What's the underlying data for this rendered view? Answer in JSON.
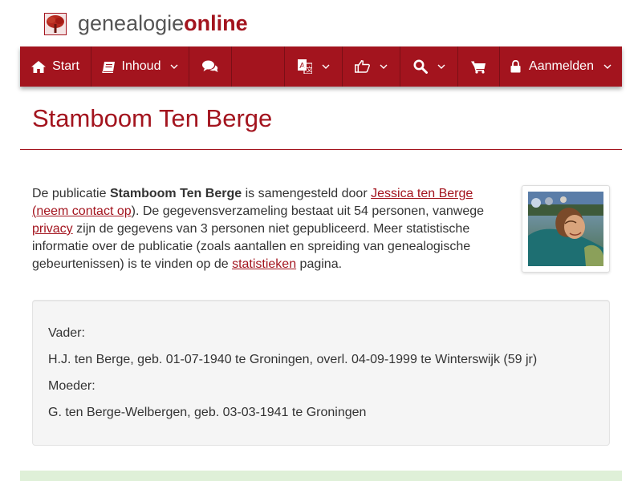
{
  "site": {
    "logo_regular": "genealogie",
    "logo_bold": "online",
    "brand_color": "#a3141e"
  },
  "nav": {
    "start_label": "Start",
    "content_label": "Inhoud",
    "login_label": "Aanmelden",
    "icons": [
      "home-icon",
      "book-icon",
      "chat-icon",
      "translate-icon",
      "thumbs-up-icon",
      "search-icon",
      "cart-icon",
      "lock-icon"
    ]
  },
  "page": {
    "title": "Stamboom Ten Berge"
  },
  "intro": {
    "t1": "De publicatie ",
    "publication": "Stamboom Ten Berge",
    "t2": " is samengesteld door ",
    "author": "Jessica ten Berge",
    "t3": "(",
    "contact_link": "neem contact op",
    "t4": "). De gegevensverzameling bestaat uit 54 personen, vanwege ",
    "privacy_link": "privacy",
    "t5": " zijn de gegevens van 3 personen niet gepubliceerd. Meer statistische informatie over de publicatie (zoals aantallen en spreiding van genealogische gebeurtenissen) is te vinden op de ",
    "stats_link": "statistieken",
    "t6": " pagina."
  },
  "parents": {
    "father_label": "Vader:",
    "father_value": "H.J. ten Berge, geb. 01-07-1940 te Groningen, overl. 04-09-1999 te Winterswijk (59 jr)",
    "mother_label": "Moeder:",
    "mother_value": "G. ten Berge-Welbergen, geb. 03-03-1941 te Groningen"
  }
}
